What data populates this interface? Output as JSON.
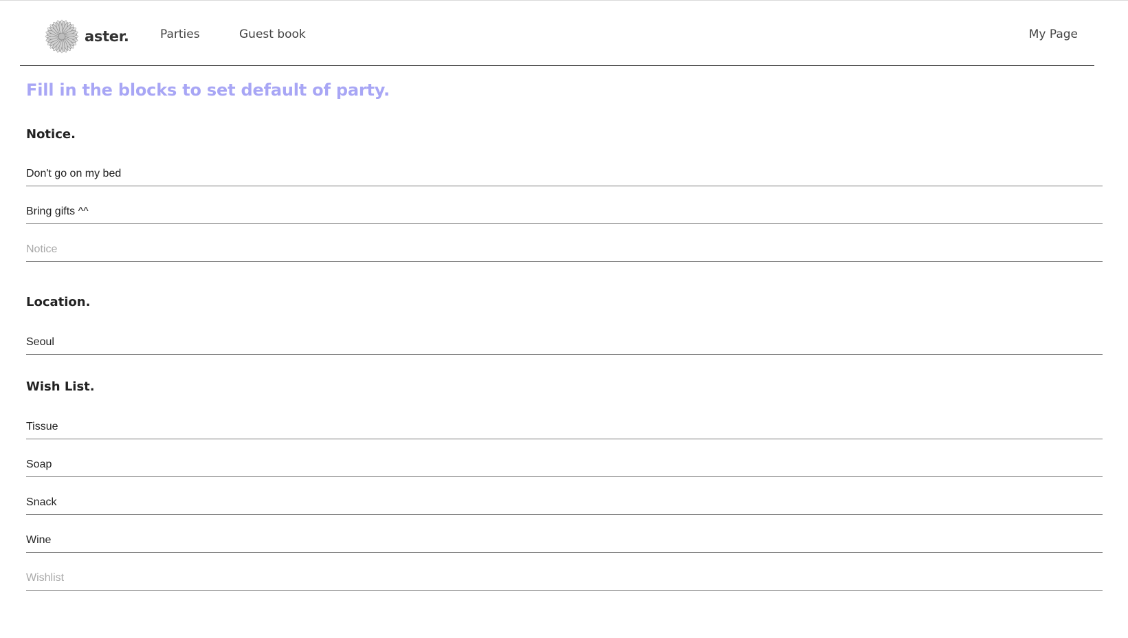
{
  "header": {
    "logo_text": "aster.",
    "nav": {
      "parties": "Parties",
      "guest_book": "Guest book",
      "my_page": "My Page"
    }
  },
  "main": {
    "heading": "Fill in the blocks to set default of party.",
    "notice": {
      "title": "Notice.",
      "items": [
        "Don't go on my bed",
        "Bring gifts ^^"
      ],
      "placeholder": "Notice"
    },
    "location": {
      "title": "Location.",
      "value": "Seoul"
    },
    "wishlist": {
      "title": "Wish List.",
      "items": [
        "Tissue",
        "Soap",
        "Snack",
        "Wine"
      ],
      "placeholder": "Wishlist"
    }
  },
  "colors": {
    "heading_accent": "#a8a6f5",
    "divider": "#777777",
    "nav_border": "#2a2a2a"
  },
  "icons": {
    "logo": "aster-flower-icon"
  }
}
